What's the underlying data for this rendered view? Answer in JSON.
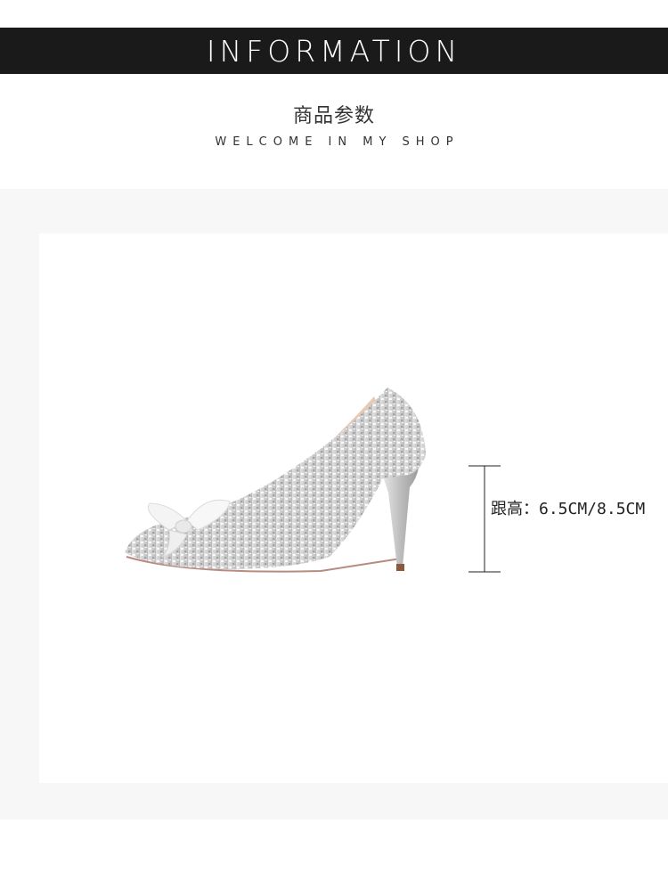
{
  "header": {
    "title": "INFORMATION",
    "subtitle_cn": "商品参数",
    "subtitle_en": "WELCOME IN MY SHOP"
  },
  "product": {
    "heel_height_label": "跟高：6.5CM/8.5CM"
  },
  "colors": {
    "banner_bg": "#1a1a1a",
    "band_bg": "#f7f7f7",
    "card_bg": "#ffffff"
  }
}
